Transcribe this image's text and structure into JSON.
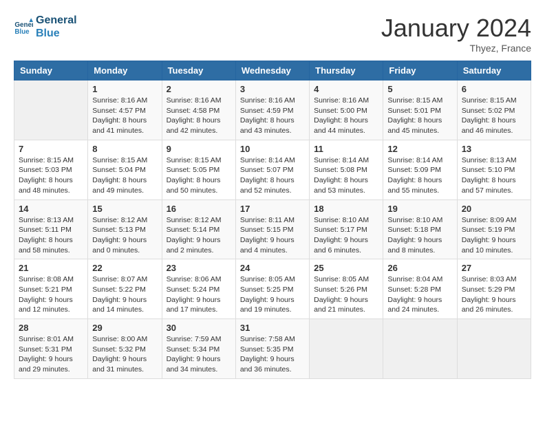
{
  "logo": {
    "line1": "General",
    "line2": "Blue"
  },
  "title": "January 2024",
  "subtitle": "Thyez, France",
  "weekdays": [
    "Sunday",
    "Monday",
    "Tuesday",
    "Wednesday",
    "Thursday",
    "Friday",
    "Saturday"
  ],
  "weeks": [
    [
      {
        "day": "",
        "info": ""
      },
      {
        "day": "1",
        "info": "Sunrise: 8:16 AM\nSunset: 4:57 PM\nDaylight: 8 hours\nand 41 minutes."
      },
      {
        "day": "2",
        "info": "Sunrise: 8:16 AM\nSunset: 4:58 PM\nDaylight: 8 hours\nand 42 minutes."
      },
      {
        "day": "3",
        "info": "Sunrise: 8:16 AM\nSunset: 4:59 PM\nDaylight: 8 hours\nand 43 minutes."
      },
      {
        "day": "4",
        "info": "Sunrise: 8:16 AM\nSunset: 5:00 PM\nDaylight: 8 hours\nand 44 minutes."
      },
      {
        "day": "5",
        "info": "Sunrise: 8:15 AM\nSunset: 5:01 PM\nDaylight: 8 hours\nand 45 minutes."
      },
      {
        "day": "6",
        "info": "Sunrise: 8:15 AM\nSunset: 5:02 PM\nDaylight: 8 hours\nand 46 minutes."
      }
    ],
    [
      {
        "day": "7",
        "info": "Sunrise: 8:15 AM\nSunset: 5:03 PM\nDaylight: 8 hours\nand 48 minutes."
      },
      {
        "day": "8",
        "info": "Sunrise: 8:15 AM\nSunset: 5:04 PM\nDaylight: 8 hours\nand 49 minutes."
      },
      {
        "day": "9",
        "info": "Sunrise: 8:15 AM\nSunset: 5:05 PM\nDaylight: 8 hours\nand 50 minutes."
      },
      {
        "day": "10",
        "info": "Sunrise: 8:14 AM\nSunset: 5:07 PM\nDaylight: 8 hours\nand 52 minutes."
      },
      {
        "day": "11",
        "info": "Sunrise: 8:14 AM\nSunset: 5:08 PM\nDaylight: 8 hours\nand 53 minutes."
      },
      {
        "day": "12",
        "info": "Sunrise: 8:14 AM\nSunset: 5:09 PM\nDaylight: 8 hours\nand 55 minutes."
      },
      {
        "day": "13",
        "info": "Sunrise: 8:13 AM\nSunset: 5:10 PM\nDaylight: 8 hours\nand 57 minutes."
      }
    ],
    [
      {
        "day": "14",
        "info": "Sunrise: 8:13 AM\nSunset: 5:11 PM\nDaylight: 8 hours\nand 58 minutes."
      },
      {
        "day": "15",
        "info": "Sunrise: 8:12 AM\nSunset: 5:13 PM\nDaylight: 9 hours\nand 0 minutes."
      },
      {
        "day": "16",
        "info": "Sunrise: 8:12 AM\nSunset: 5:14 PM\nDaylight: 9 hours\nand 2 minutes."
      },
      {
        "day": "17",
        "info": "Sunrise: 8:11 AM\nSunset: 5:15 PM\nDaylight: 9 hours\nand 4 minutes."
      },
      {
        "day": "18",
        "info": "Sunrise: 8:10 AM\nSunset: 5:17 PM\nDaylight: 9 hours\nand 6 minutes."
      },
      {
        "day": "19",
        "info": "Sunrise: 8:10 AM\nSunset: 5:18 PM\nDaylight: 9 hours\nand 8 minutes."
      },
      {
        "day": "20",
        "info": "Sunrise: 8:09 AM\nSunset: 5:19 PM\nDaylight: 9 hours\nand 10 minutes."
      }
    ],
    [
      {
        "day": "21",
        "info": "Sunrise: 8:08 AM\nSunset: 5:21 PM\nDaylight: 9 hours\nand 12 minutes."
      },
      {
        "day": "22",
        "info": "Sunrise: 8:07 AM\nSunset: 5:22 PM\nDaylight: 9 hours\nand 14 minutes."
      },
      {
        "day": "23",
        "info": "Sunrise: 8:06 AM\nSunset: 5:24 PM\nDaylight: 9 hours\nand 17 minutes."
      },
      {
        "day": "24",
        "info": "Sunrise: 8:05 AM\nSunset: 5:25 PM\nDaylight: 9 hours\nand 19 minutes."
      },
      {
        "day": "25",
        "info": "Sunrise: 8:05 AM\nSunset: 5:26 PM\nDaylight: 9 hours\nand 21 minutes."
      },
      {
        "day": "26",
        "info": "Sunrise: 8:04 AM\nSunset: 5:28 PM\nDaylight: 9 hours\nand 24 minutes."
      },
      {
        "day": "27",
        "info": "Sunrise: 8:03 AM\nSunset: 5:29 PM\nDaylight: 9 hours\nand 26 minutes."
      }
    ],
    [
      {
        "day": "28",
        "info": "Sunrise: 8:01 AM\nSunset: 5:31 PM\nDaylight: 9 hours\nand 29 minutes."
      },
      {
        "day": "29",
        "info": "Sunrise: 8:00 AM\nSunset: 5:32 PM\nDaylight: 9 hours\nand 31 minutes."
      },
      {
        "day": "30",
        "info": "Sunrise: 7:59 AM\nSunset: 5:34 PM\nDaylight: 9 hours\nand 34 minutes."
      },
      {
        "day": "31",
        "info": "Sunrise: 7:58 AM\nSunset: 5:35 PM\nDaylight: 9 hours\nand 36 minutes."
      },
      {
        "day": "",
        "info": ""
      },
      {
        "day": "",
        "info": ""
      },
      {
        "day": "",
        "info": ""
      }
    ]
  ]
}
